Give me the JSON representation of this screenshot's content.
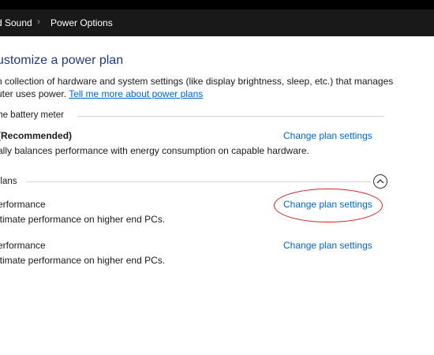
{
  "breadcrumb": {
    "items": [
      "d Sound",
      "Power Options"
    ],
    "separator": "›"
  },
  "page": {
    "title": "ustomize a power plan",
    "description_line1": "n collection of hardware and system settings (like display brightness, sleep, etc.) that manages",
    "description_line2_prefix": "uter uses power.",
    "learn_more_link": "Tell me more about power plans"
  },
  "sections": {
    "battery_meter_label": "the battery meter",
    "additional_plans_label": "plans"
  },
  "plans": [
    {
      "name": "(Recommended)",
      "description": "ally balances performance with energy consumption on capable hardware.",
      "link": "Change plan settings"
    },
    {
      "name": "erformance",
      "description": "ltimate performance on higher end PCs.",
      "link": "Change plan settings"
    },
    {
      "name": "erformance",
      "description": "ltimate performance on higher end PCs.",
      "link": "Change plan settings"
    }
  ],
  "icons": {
    "collapse": "chevron-up-icon"
  },
  "colors": {
    "link": "#0066cc",
    "heading": "#1e3c78",
    "breadcrumb_bg": "#191919",
    "highlight": "#d6201f"
  }
}
